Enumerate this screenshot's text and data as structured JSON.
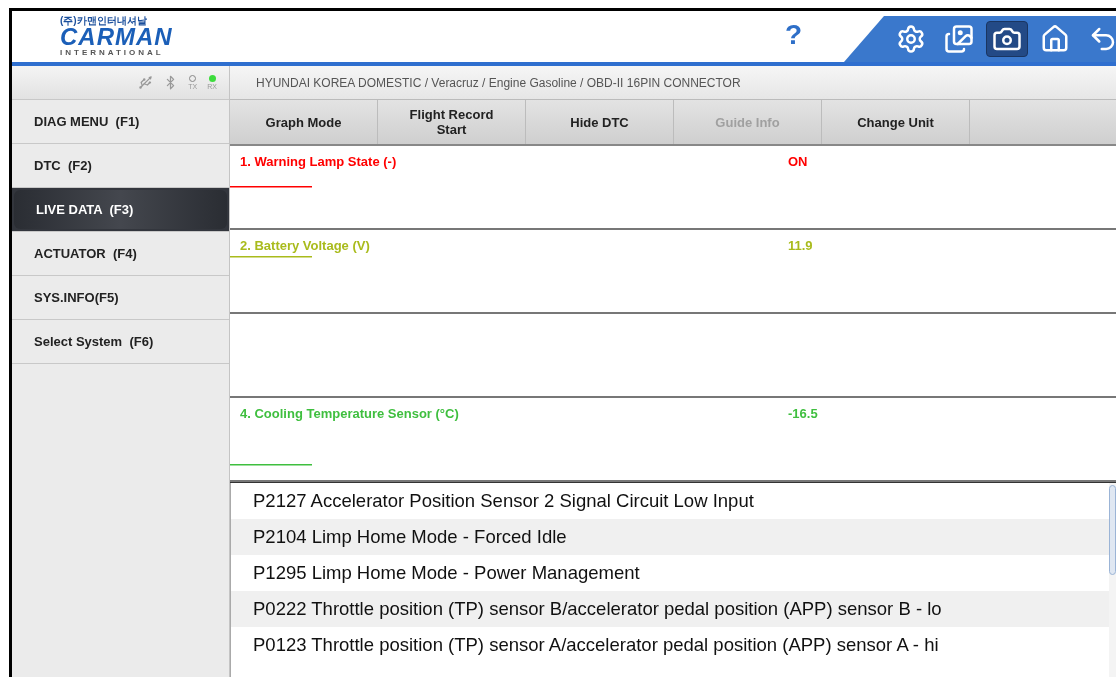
{
  "logo": {
    "company_korean": "(주)카맨인터내셔날",
    "brand": "CARMAN",
    "subtitle": "INTERNATIONAL"
  },
  "header": {
    "help": "?",
    "tools": [
      {
        "kind": "settings",
        "selected": false
      },
      {
        "kind": "save",
        "selected": false
      },
      {
        "kind": "camera",
        "selected": true
      },
      {
        "kind": "home",
        "selected": false
      },
      {
        "kind": "back",
        "selected": false
      }
    ]
  },
  "status": {
    "tx": {
      "label": "TX",
      "on": false
    },
    "rx": {
      "label": "RX",
      "on": true
    }
  },
  "sidebar": {
    "items": [
      {
        "label": "DIAG MENU  (F1)",
        "selected": false
      },
      {
        "label": "DTC  (F2)",
        "selected": false
      },
      {
        "label": "LIVE DATA  (F3)",
        "selected": true
      },
      {
        "label": "ACTUATOR  (F4)",
        "selected": false
      },
      {
        "label": "SYS.INFO(F5)",
        "selected": false
      },
      {
        "label": "Select System  (F6)",
        "selected": false
      }
    ]
  },
  "breadcrumb": "HYUNDAI KOREA DOMESTIC / Veracruz / Engine Gasoline / OBD-II 16PIN CONNECTOR",
  "toolbar": [
    {
      "label": "Graph Mode",
      "disabled": false
    },
    {
      "label": "Flight Record Start",
      "disabled": false
    },
    {
      "label": "Hide DTC",
      "disabled": false
    },
    {
      "label": "Guide Info",
      "disabled": true
    },
    {
      "label": "Change Unit",
      "disabled": false
    }
  ],
  "parameters": [
    {
      "kind": "param",
      "name": "1. Warning Lamp State (-)",
      "value": "ON",
      "color": "#ff0000"
    },
    {
      "kind": "param",
      "name": "2. Battery Voltage (V)",
      "value": "11.9",
      "color": "#a9bb1c"
    },
    {
      "kind": "blank"
    },
    {
      "kind": "param",
      "name": "4. Cooling Temperature Sensor (°C)",
      "value": "-16.5",
      "color": "#3fbf3f"
    }
  ],
  "dtc_list": [
    "P2127 Accelerator Position Sensor 2 Signal Circuit Low Input",
    "P2104 Limp Home Mode - Forced Idle",
    "P1295 Limp Home Mode - Power Management",
    "P0222 Throttle position (TP) sensor B/accelerator pedal position (APP) sensor B - lo",
    "P0123 Throttle position (TP) sensor A/accelerator pedal position (APP) sensor A - hi"
  ]
}
